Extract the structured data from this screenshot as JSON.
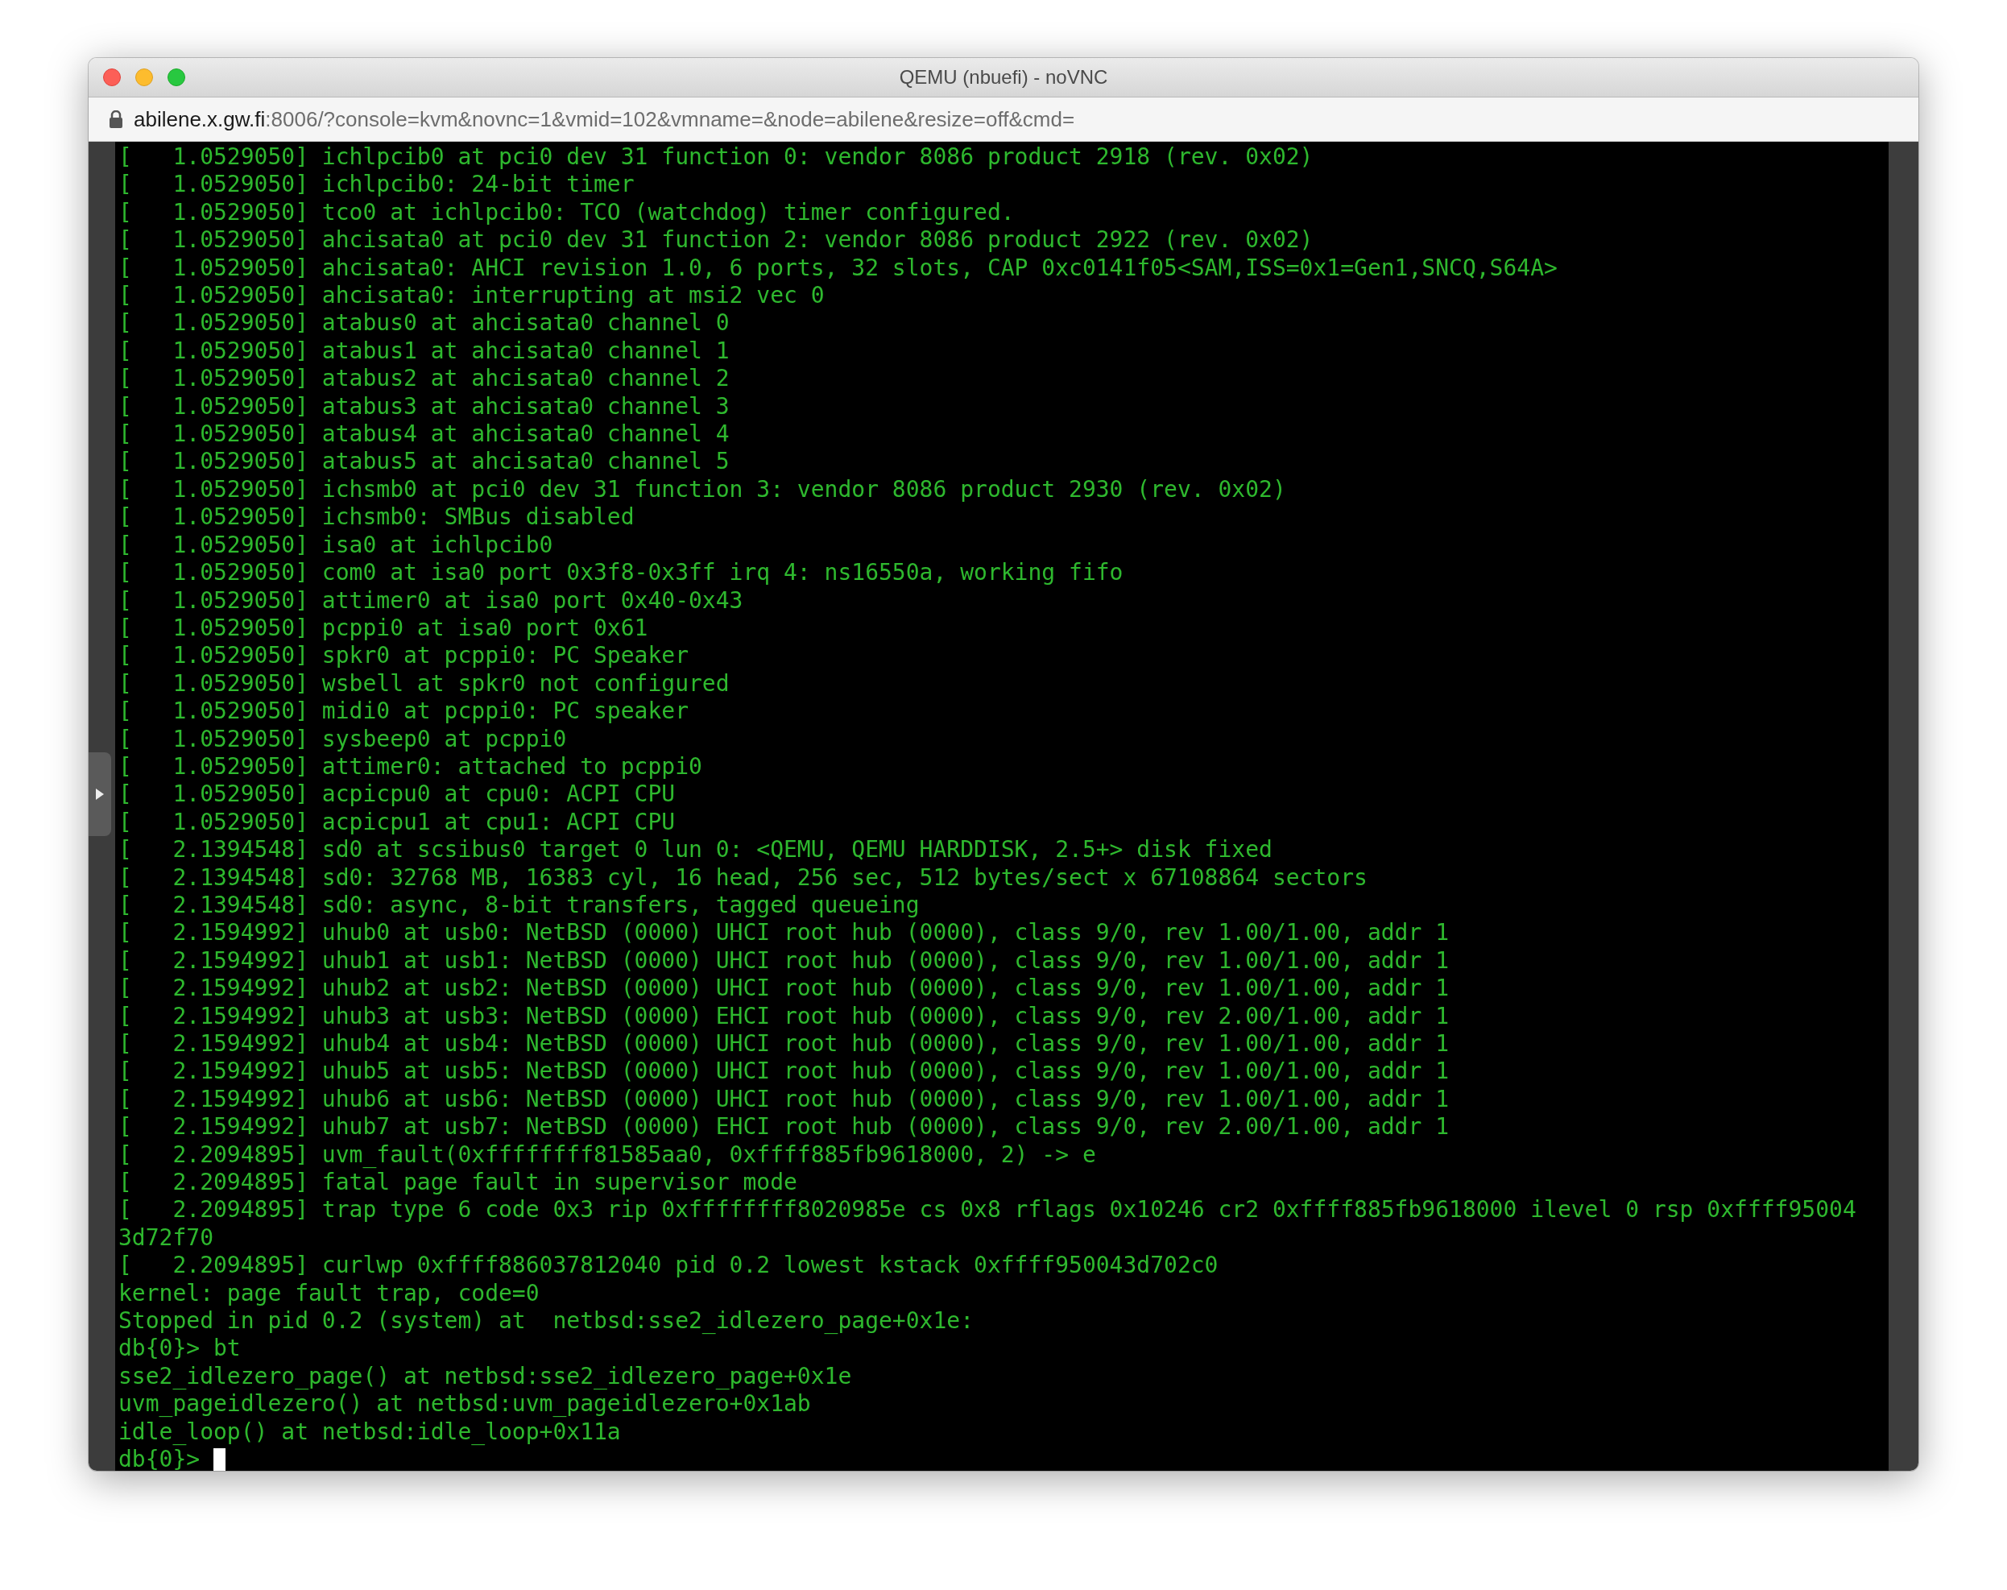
{
  "window": {
    "title": "QEMU (nbuefi) - noVNC"
  },
  "address_bar": {
    "host": "abilene.x.gw.fi",
    "path": ":8006/?console=kvm&novnc=1&vmid=102&vmname=&node=abilene&resize=off&cmd=",
    "secure": true
  },
  "sidebar_handle": {
    "expanded": false
  },
  "terminal": {
    "cursor_visible": true,
    "prompt": "db{0}>",
    "lines": [
      "[   1.0529050] ichlpcib0 at pci0 dev 31 function 0: vendor 8086 product 2918 (rev. 0x02)",
      "[   1.0529050] ichlpcib0: 24-bit timer",
      "[   1.0529050] tco0 at ichlpcib0: TCO (watchdog) timer configured.",
      "[   1.0529050] ahcisata0 at pci0 dev 31 function 2: vendor 8086 product 2922 (rev. 0x02)",
      "[   1.0529050] ahcisata0: AHCI revision 1.0, 6 ports, 32 slots, CAP 0xc0141f05<SAM,ISS=0x1=Gen1,SNCQ,S64A>",
      "[   1.0529050] ahcisata0: interrupting at msi2 vec 0",
      "[   1.0529050] atabus0 at ahcisata0 channel 0",
      "[   1.0529050] atabus1 at ahcisata0 channel 1",
      "[   1.0529050] atabus2 at ahcisata0 channel 2",
      "[   1.0529050] atabus3 at ahcisata0 channel 3",
      "[   1.0529050] atabus4 at ahcisata0 channel 4",
      "[   1.0529050] atabus5 at ahcisata0 channel 5",
      "[   1.0529050] ichsmb0 at pci0 dev 31 function 3: vendor 8086 product 2930 (rev. 0x02)",
      "[   1.0529050] ichsmb0: SMBus disabled",
      "[   1.0529050] isa0 at ichlpcib0",
      "[   1.0529050] com0 at isa0 port 0x3f8-0x3ff irq 4: ns16550a, working fifo",
      "[   1.0529050] attimer0 at isa0 port 0x40-0x43",
      "[   1.0529050] pcppi0 at isa0 port 0x61",
      "[   1.0529050] spkr0 at pcppi0: PC Speaker",
      "[   1.0529050] wsbell at spkr0 not configured",
      "[   1.0529050] midi0 at pcppi0: PC speaker",
      "[   1.0529050] sysbeep0 at pcppi0",
      "[   1.0529050] attimer0: attached to pcppi0",
      "[   1.0529050] acpicpu0 at cpu0: ACPI CPU",
      "[   1.0529050] acpicpu1 at cpu1: ACPI CPU",
      "[   2.1394548] sd0 at scsibus0 target 0 lun 0: <QEMU, QEMU HARDDISK, 2.5+> disk fixed",
      "[   2.1394548] sd0: 32768 MB, 16383 cyl, 16 head, 256 sec, 512 bytes/sect x 67108864 sectors",
      "[   2.1394548] sd0: async, 8-bit transfers, tagged queueing",
      "[   2.1594992] uhub0 at usb0: NetBSD (0000) UHCI root hub (0000), class 9/0, rev 1.00/1.00, addr 1",
      "[   2.1594992] uhub1 at usb1: NetBSD (0000) UHCI root hub (0000), class 9/0, rev 1.00/1.00, addr 1",
      "[   2.1594992] uhub2 at usb2: NetBSD (0000) UHCI root hub (0000), class 9/0, rev 1.00/1.00, addr 1",
      "[   2.1594992] uhub3 at usb3: NetBSD (0000) EHCI root hub (0000), class 9/0, rev 2.00/1.00, addr 1",
      "[   2.1594992] uhub4 at usb4: NetBSD (0000) UHCI root hub (0000), class 9/0, rev 1.00/1.00, addr 1",
      "[   2.1594992] uhub5 at usb5: NetBSD (0000) UHCI root hub (0000), class 9/0, rev 1.00/1.00, addr 1",
      "[   2.1594992] uhub6 at usb6: NetBSD (0000) UHCI root hub (0000), class 9/0, rev 1.00/1.00, addr 1",
      "[   2.1594992] uhub7 at usb7: NetBSD (0000) EHCI root hub (0000), class 9/0, rev 2.00/1.00, addr 1",
      "[   2.2094895] uvm_fault(0xffffffff81585aa0, 0xffff885fb9618000, 2) -> e",
      "[   2.2094895] fatal page fault in supervisor mode",
      "[   2.2094895] trap type 6 code 0x3 rip 0xffffffff8020985e cs 0x8 rflags 0x10246 cr2 0xffff885fb9618000 ilevel 0 rsp 0xffff95004",
      "3d72f70",
      "[   2.2094895] curlwp 0xffff886037812040 pid 0.2 lowest kstack 0xffff950043d702c0",
      "kernel: page fault trap, code=0",
      "Stopped in pid 0.2 (system) at  netbsd:sse2_idlezero_page+0x1e:",
      "db{0}> bt",
      "sse2_idlezero_page() at netbsd:sse2_idlezero_page+0x1e",
      "uvm_pageidlezero() at netbsd:uvm_pageidlezero+0x1ab",
      "idle_loop() at netbsd:idle_loop+0x11a"
    ]
  }
}
